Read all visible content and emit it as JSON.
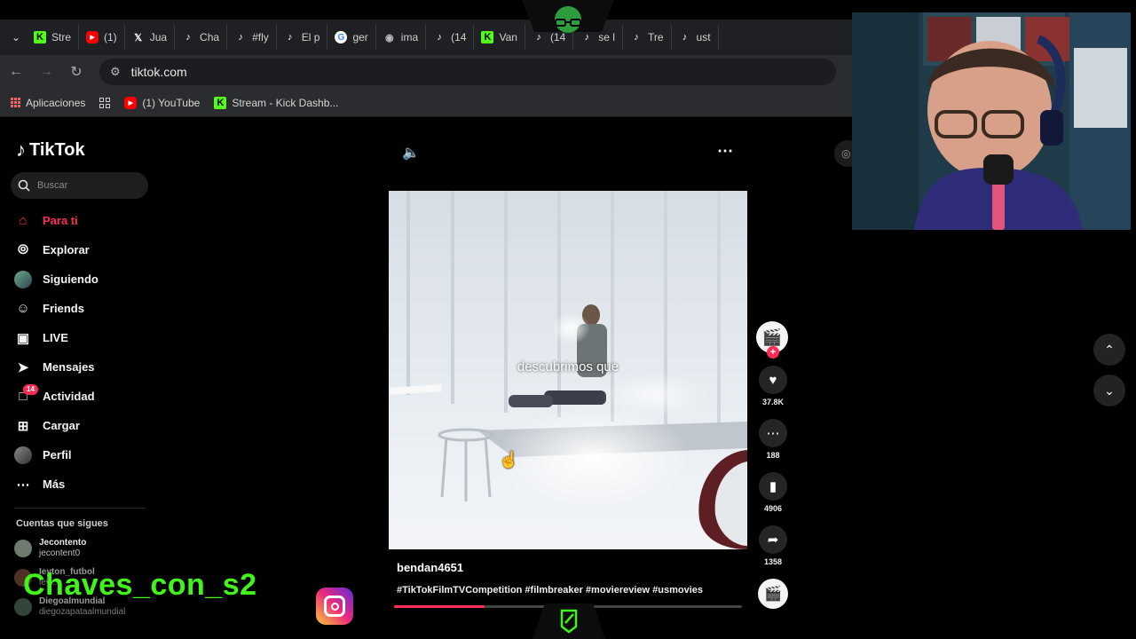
{
  "tabs": [
    {
      "label": "Stre",
      "icon": "kick-icon"
    },
    {
      "label": "(1)",
      "icon": "youtube-icon"
    },
    {
      "label": "Jua",
      "icon": "x-icon"
    },
    {
      "label": "Cha",
      "icon": "tiktok-icon"
    },
    {
      "label": "#fly",
      "icon": "tiktok-icon"
    },
    {
      "label": "El p",
      "icon": "tiktok-icon"
    },
    {
      "label": "ger",
      "icon": "google-icon"
    },
    {
      "label": "ima",
      "icon": "globe-icon"
    },
    {
      "label": "(14",
      "icon": "tiktok-icon"
    },
    {
      "label": "Van",
      "icon": "kick-icon"
    },
    {
      "label": "(14",
      "icon": "tiktok-icon"
    },
    {
      "label": "se l",
      "icon": "tiktok-icon"
    },
    {
      "label": "Tre",
      "icon": "tiktok-icon"
    },
    {
      "label": "ust",
      "icon": "tiktok-icon"
    }
  ],
  "address": {
    "url": "tiktok.com"
  },
  "bookmarks": {
    "apps": "Aplicaciones",
    "youtube": "(1) YouTube",
    "kick": "Stream - Kick Dashb..."
  },
  "tiktok": {
    "logo": "TikTok",
    "search_placeholder": "Buscar",
    "nav": {
      "for_you": "Para ti",
      "explore": "Explorar",
      "following": "Siguiendo",
      "friends": "Friends",
      "live": "LIVE",
      "messages": "Mensajes",
      "activity": "Actividad",
      "activity_badge": "14",
      "upload": "Cargar",
      "profile": "Perfil",
      "more": "Más"
    },
    "following_title": "Cuentas que sigues",
    "following_accounts": [
      {
        "name": "Jecontento",
        "user": "jecontent0"
      },
      {
        "name": "Ieyton_futbol",
        "user": "lev..."
      },
      {
        "name": "Diegoalmundial",
        "user": "diegozapataalmundial"
      }
    ],
    "video": {
      "subtitle": "descubrimos que",
      "author": "bendan4651",
      "description": "#TikTokFilmTVCompetition #filmbreaker #moviereview #usmovies",
      "progress": 0.26
    },
    "actions": {
      "likes": "37.8K",
      "comments": "188",
      "saves": "4906",
      "shares": "1358"
    }
  },
  "stream": {
    "overlay_name": "Chaves_con_s2",
    "name_color": "#41f51a"
  },
  "colors": {
    "accent": "#fe2c55",
    "kick": "#53fc18"
  }
}
